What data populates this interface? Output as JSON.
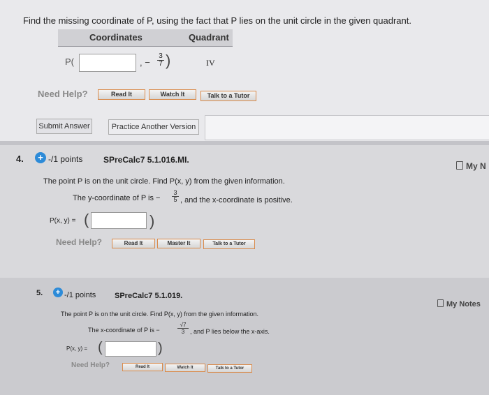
{
  "q3": {
    "prompt": "Find the missing coordinate of P, using the fact that P lies on the unit circle in the given quadrant.",
    "headers": {
      "coordinates": "Coordinates",
      "quadrant": "Quadrant"
    },
    "point_label": "P(",
    "comma_minus": ", −",
    "given_frac": {
      "num": "3",
      "den": "7"
    },
    "close": ")",
    "quadrant": "IV",
    "input_value": "",
    "need_help": "Need Help?",
    "buttons": {
      "read": "Read It",
      "watch": "Watch It",
      "tutor": "Talk to a Tutor"
    },
    "submit": "Submit Answer",
    "practice": "Practice Another Version"
  },
  "q4": {
    "number": "4.",
    "points": "-/1 points",
    "source": "SPreCalc7 5.1.016.MI.",
    "my_notes": "My N",
    "line1": "The point P is on the unit circle. Find P(x, y) from the given information.",
    "line2_pre": "The y-coordinate of P is  −",
    "frac": {
      "num": "3",
      "den": "5"
    },
    "line2_post": ", and the x-coordinate is positive.",
    "answer_label": "P(x, y) =",
    "need_help": "Need Help?",
    "buttons": {
      "read": "Read It",
      "master": "Master It",
      "tutor": "Talk to a Tutor"
    }
  },
  "q5": {
    "number": "5.",
    "points": "-/1 points",
    "source": "SPreCalc7 5.1.019.",
    "my_notes": "My Notes",
    "line1": "The point P is on the unit circle. Find P(x, y) from the given information.",
    "line2_pre": "The x-coordinate of P is  −",
    "frac": {
      "num": "√7",
      "den": "3"
    },
    "line2_post": ", and P lies below the x-axis.",
    "answer_label": "P(x, y) =",
    "need_help": "Need Help?",
    "buttons": {
      "read": "Read It",
      "watch": "Watch It",
      "tutor": "Talk to a Tutor"
    }
  }
}
